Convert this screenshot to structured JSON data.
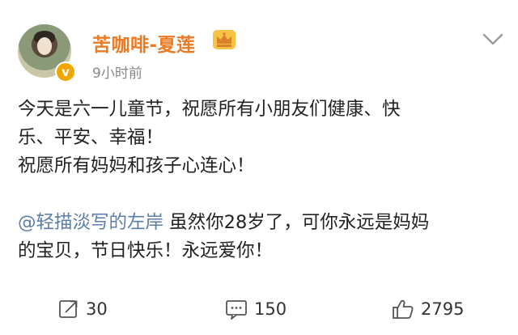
{
  "post": {
    "username": "苦咖啡-夏莲",
    "timestamp": "9小时前",
    "verified_mark": "v",
    "line1": "今天是六一儿童节，祝愿所有小朋友们健康、快",
    "line2": "乐、平安、幸福！",
    "line3": "祝愿所有妈妈和孩子心连心！",
    "mention": "@轻描淡写的左岸",
    "mention_text_a": " 虽然你28岁了，可你永远是妈妈",
    "mention_text_b": "的宝贝，节日快乐！永远爱你！"
  },
  "actions": {
    "repost_count": "30",
    "comment_count": "150",
    "like_count": "2795"
  },
  "icons": {
    "crown": "crown-icon",
    "chevron": "chevron-down-icon",
    "repost": "repost-icon",
    "comment": "comment-icon",
    "like": "thumbs-up-icon"
  },
  "colors": {
    "username": "#eb7a24",
    "mention": "#5b7ea8",
    "verified": "#f0a800"
  }
}
